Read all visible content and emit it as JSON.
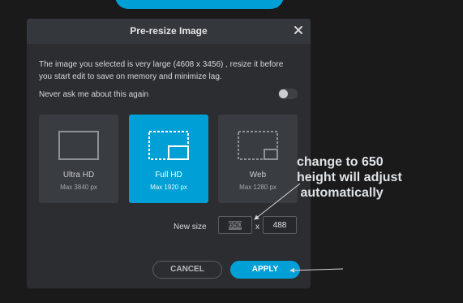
{
  "dialog": {
    "title": "Pre-resize Image",
    "description": "The image you selected is very large (4608 x 3456) , resize it before you start edit to save on memory and minimize lag.",
    "never_ask_label": "Never ask me about this again",
    "never_ask_enabled": false,
    "options": [
      {
        "label": "Ultra HD",
        "sub": "Max 3840 px",
        "selected": false
      },
      {
        "label": "Full HD",
        "sub": "Max 1920 px",
        "selected": true
      },
      {
        "label": "Web",
        "sub": "Max 1280 px",
        "selected": false
      }
    ],
    "new_size": {
      "label": "New size",
      "width": "650",
      "separator": "x",
      "height": "488"
    },
    "buttons": {
      "cancel": "CANCEL",
      "apply": "APPLY"
    }
  },
  "annotation": {
    "lines": [
      "change to 650",
      "height will adjust",
      " automatically"
    ]
  },
  "colors": {
    "accent": "#00a0d6",
    "dialog_bg": "#2b2d30",
    "page_bg": "#1a1a1a"
  },
  "icons": {
    "close": "close-icon",
    "ultra_hd": "monitor-icon",
    "full_hd": "resize-icon",
    "web": "resize-small-icon"
  }
}
